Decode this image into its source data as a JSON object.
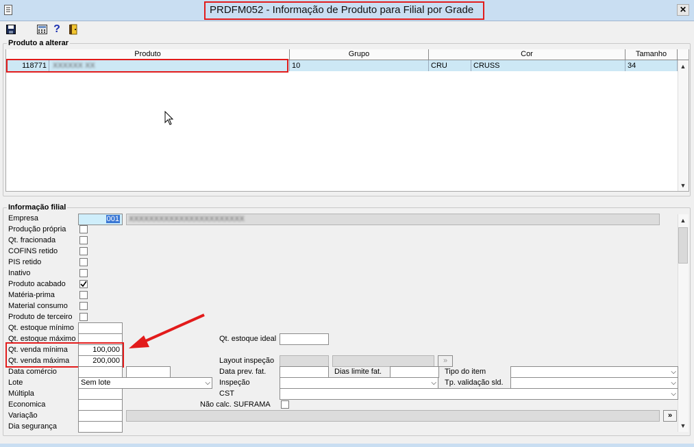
{
  "window": {
    "title": "PRDFM052 - Informação de Produto para Filial por Grade",
    "close_glyph": "✕"
  },
  "toolbar": {
    "icons": [
      "save-icon",
      "calculator-icon",
      "help-icon",
      "exit-door-icon"
    ]
  },
  "product_group": {
    "label": "Produto a alterar",
    "columns": [
      "Produto",
      "Grupo",
      "Cor",
      "Tamanho"
    ],
    "row": {
      "produto_code": "118771",
      "produto_desc": "XXXXXX XX",
      "grupo": "10",
      "cor_code": "CRU",
      "cor_name": "CRUSS",
      "tamanho": "34"
    }
  },
  "info_group": {
    "label": "Informação filial",
    "labels": {
      "empresa": "Empresa",
      "producao_propria": "Produção própria",
      "qt_fracionada": "Qt. fracionada",
      "cofins_retido": "COFINS retido",
      "pis_retido": "PIS retido",
      "inativo": "Inativo",
      "produto_acabado": "Produto acabado",
      "materia_prima": "Matéria-prima",
      "material_consumo": "Material consumo",
      "produto_terceiro": "Produto de terceiro",
      "qt_estoque_minimo": "Qt. estoque mínimo",
      "qt_estoque_maximo": "Qt. estoque máximo",
      "qt_venda_minima": "Qt. venda mínima",
      "qt_venda_maxima": "Qt. venda máxima",
      "data_comercio": "Data comércio",
      "lote": "Lote",
      "multipla": "Múltipla",
      "economica": "Economica",
      "variacao": "Variação",
      "dia_seguranca": "Dia segurança",
      "qt_estoque_ideal": "Qt. estoque ideal",
      "layout_inspecao": "Layout inspeção",
      "data_prev_fat": "Data prev. fat.",
      "dias_limite_fat": "Dias limite fat.",
      "tipo_item": "Tipo do item",
      "inspecao": "Inspeção",
      "tp_validacao_sld": "Tp. validação sld.",
      "cst": "CST",
      "nao_calc_suframa": "Não calc. SUFRAMA"
    },
    "values": {
      "empresa_code": "001",
      "empresa_name": "XXXXXXXXXXXXXXXXXXXXXXX",
      "qt_venda_minima": "100,000",
      "qt_venda_maxima": "200,000",
      "lote": "Sem lote",
      "expand_button": "»"
    },
    "checks": {
      "producao_propria": false,
      "qt_fracionada": false,
      "cofins_retido": false,
      "pis_retido": false,
      "inativo": false,
      "produto_acabado": true,
      "materia_prima": false,
      "material_consumo": false,
      "produto_terceiro": false,
      "nao_calc_suframa": false
    }
  },
  "colors": {
    "highlight": "#e21b1b",
    "selection": "#cde8f5",
    "titlebar": "#c9def2"
  }
}
